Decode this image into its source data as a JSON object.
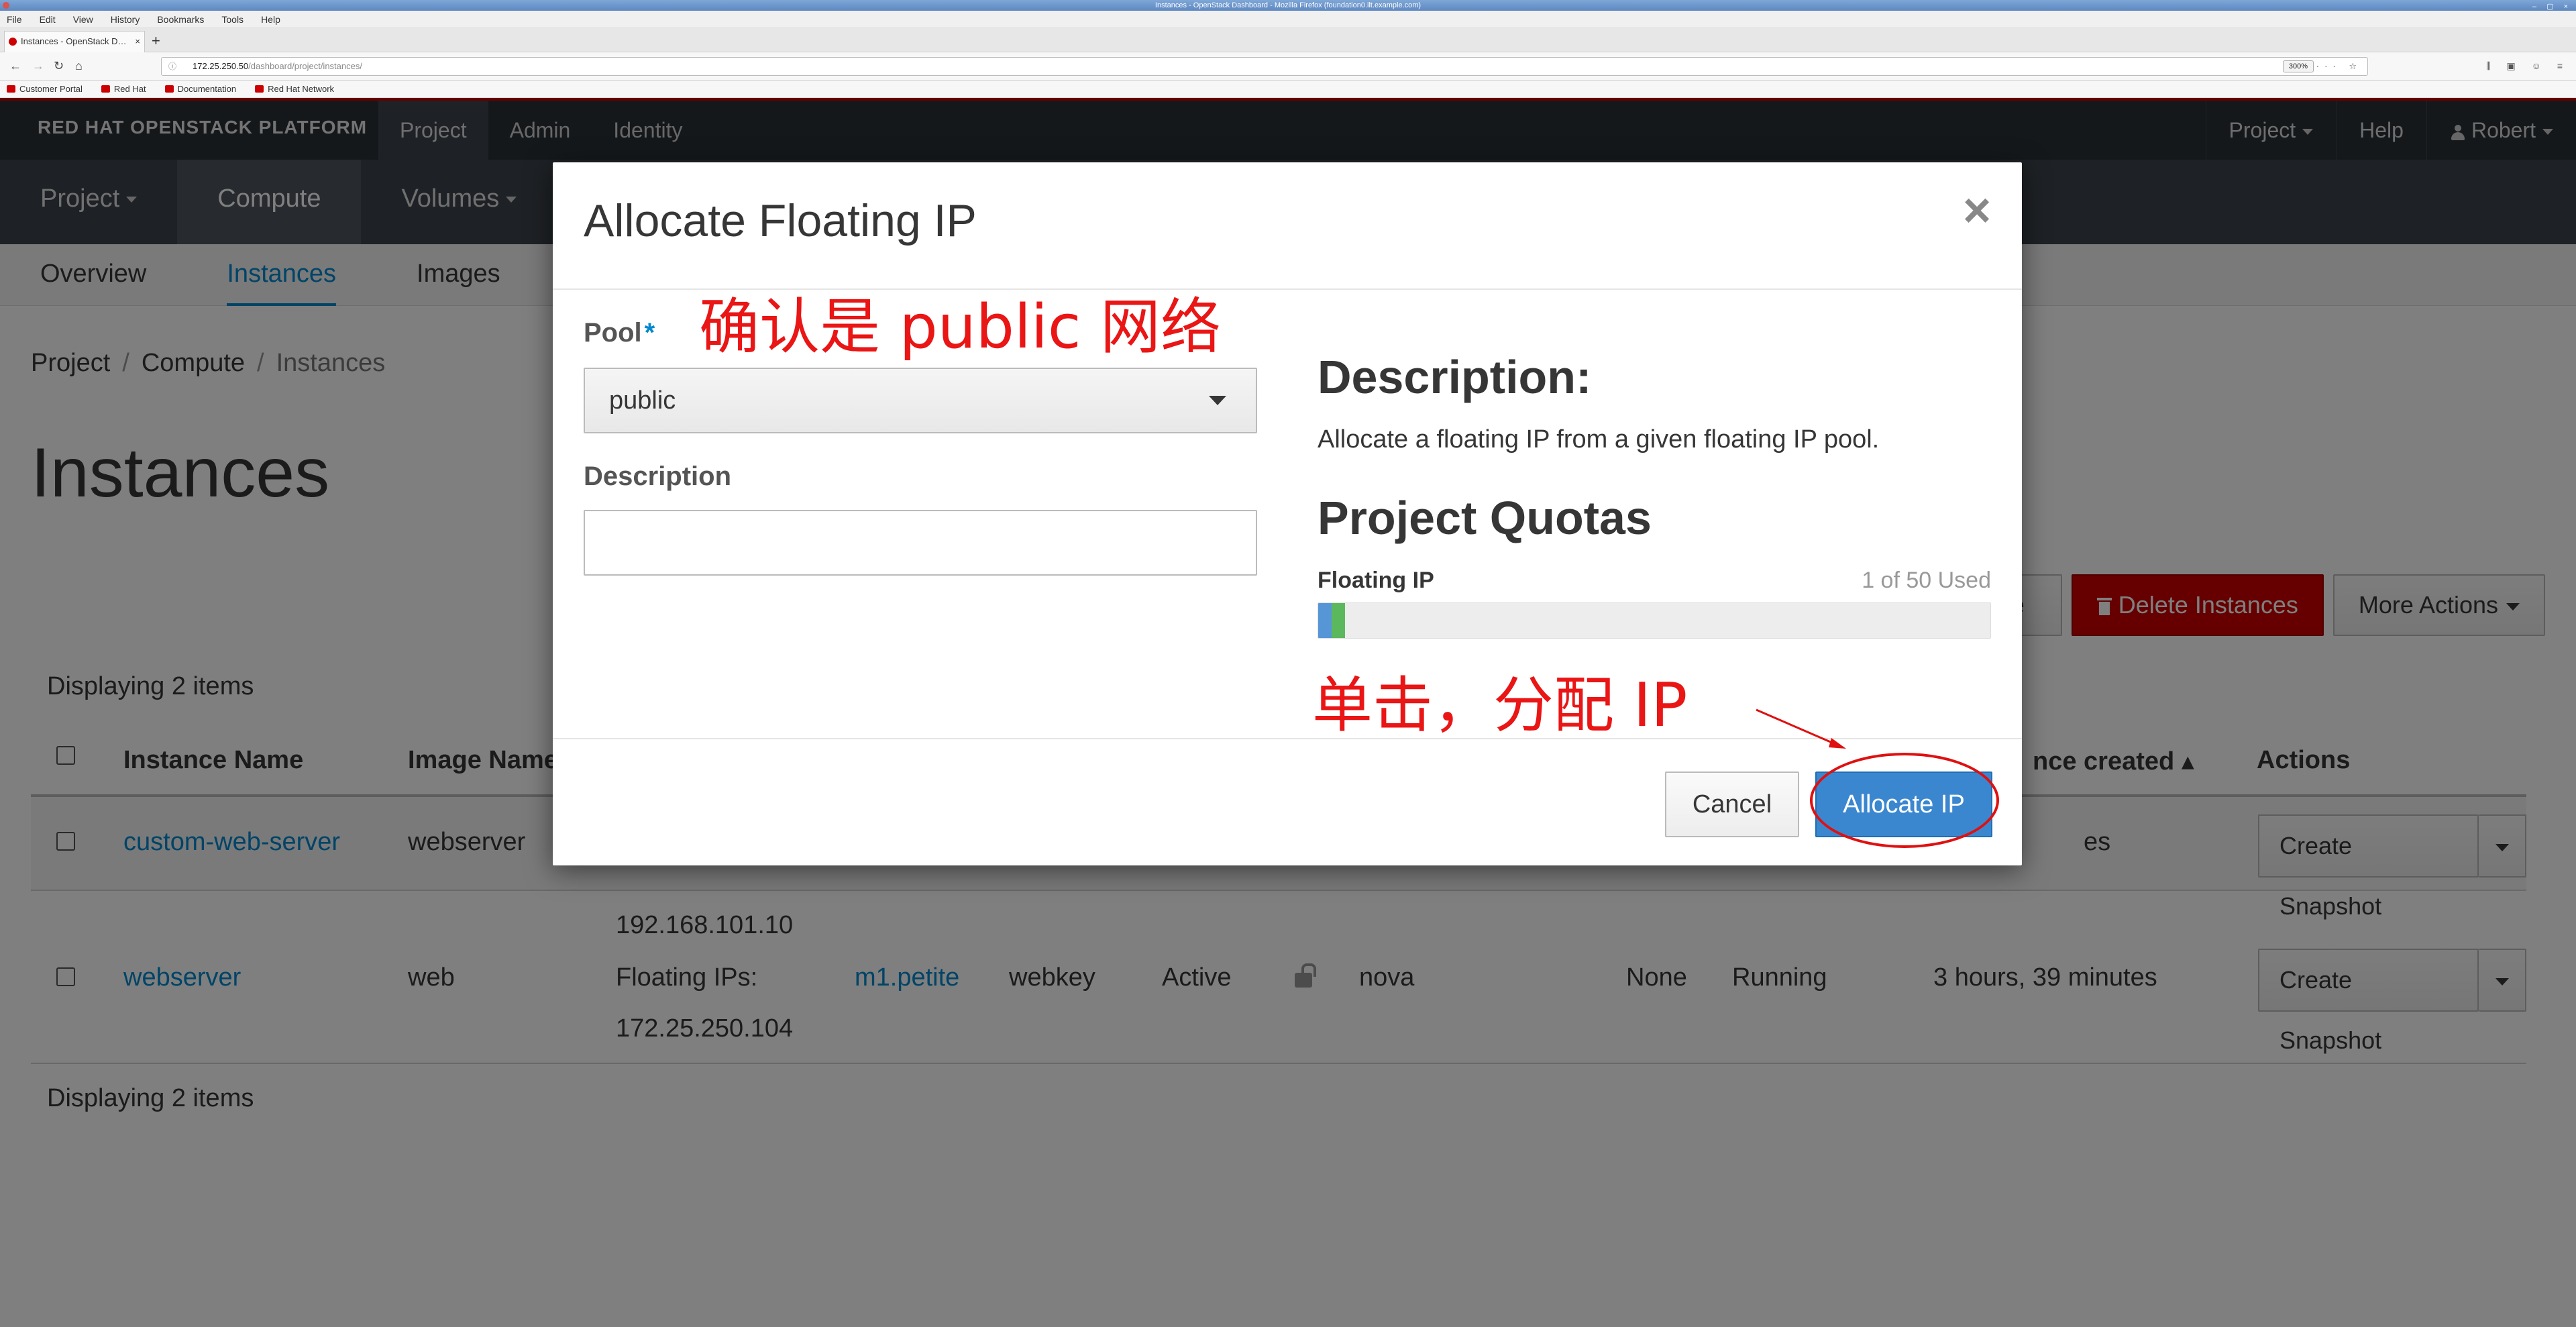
{
  "browser": {
    "window_title": "Instances - OpenStack Dashboard - Mozilla Firefox (foundation0.ilt.example.com)",
    "menu": [
      "File",
      "Edit",
      "View",
      "History",
      "Bookmarks",
      "Tools",
      "Help"
    ],
    "tab_title": "Instances - OpenStack D…",
    "url_host": "172.25.250.50",
    "url_path": "/dashboard/project/instances/",
    "zoom": "300%",
    "bookmarks": [
      "Customer Portal",
      "Red Hat",
      "Documentation",
      "Red Hat Network"
    ]
  },
  "header": {
    "brand": "RED HAT OPENSTACK PLATFORM",
    "nav": [
      "Project",
      "Admin",
      "Identity"
    ],
    "right": {
      "project": "Project",
      "help": "Help",
      "user": "Robert"
    }
  },
  "subnav": [
    "Project",
    "Compute",
    "Volumes"
  ],
  "tertnav": [
    "Overview",
    "Instances",
    "Images"
  ],
  "breadcrumb": [
    "Project",
    "Compute",
    "Instances"
  ],
  "page_title": "Instances",
  "actions": {
    "partial": "e",
    "delete": "Delete Instances",
    "more": "More Actions"
  },
  "displaying": "Displaying 2 items",
  "table": {
    "headers": {
      "name": "Instance Name",
      "image": "Image Name",
      "created": "nce created",
      "actions": "Actions"
    },
    "rows": [
      {
        "name": "custom-web-server",
        "image": "webserver",
        "created_partial": "es",
        "action": "Create Snapshot"
      },
      {
        "name": "webserver",
        "image": "web",
        "ip_lines": [
          "192.168.101.10",
          "Floating IPs:",
          "172.25.250.104"
        ],
        "flavor": "m1.petite",
        "keypair": "webkey",
        "status": "Active",
        "az": "nova",
        "task": "None",
        "power": "Running",
        "created": "3 hours, 39 minutes",
        "action": "Create Snapshot"
      }
    ]
  },
  "modal": {
    "title": "Allocate Floating IP",
    "close": "×",
    "pool_label": "Pool",
    "required_mark": "*",
    "pool_value": "public",
    "description_label": "Description",
    "desc_heading": "Description:",
    "desc_text": "Allocate a floating IP from a given floating IP pool.",
    "quota_heading": "Project Quotas",
    "quota_label": "Floating IP",
    "quota_used": "1 of 50 Used",
    "quota_used_fraction": 0.02,
    "quota_new_fraction": 0.02,
    "cancel": "Cancel",
    "allocate": "Allocate IP"
  },
  "annotations": {
    "pool_note": "确认是 public 网络",
    "click_note": "单击，分配 IP",
    "color": "#ea1515"
  },
  "colors": {
    "accent": "#0088ce",
    "danger": "#cc0000",
    "primary": "#3a87cf",
    "progress_used": "#5696d6",
    "progress_new": "#5cb85c"
  }
}
